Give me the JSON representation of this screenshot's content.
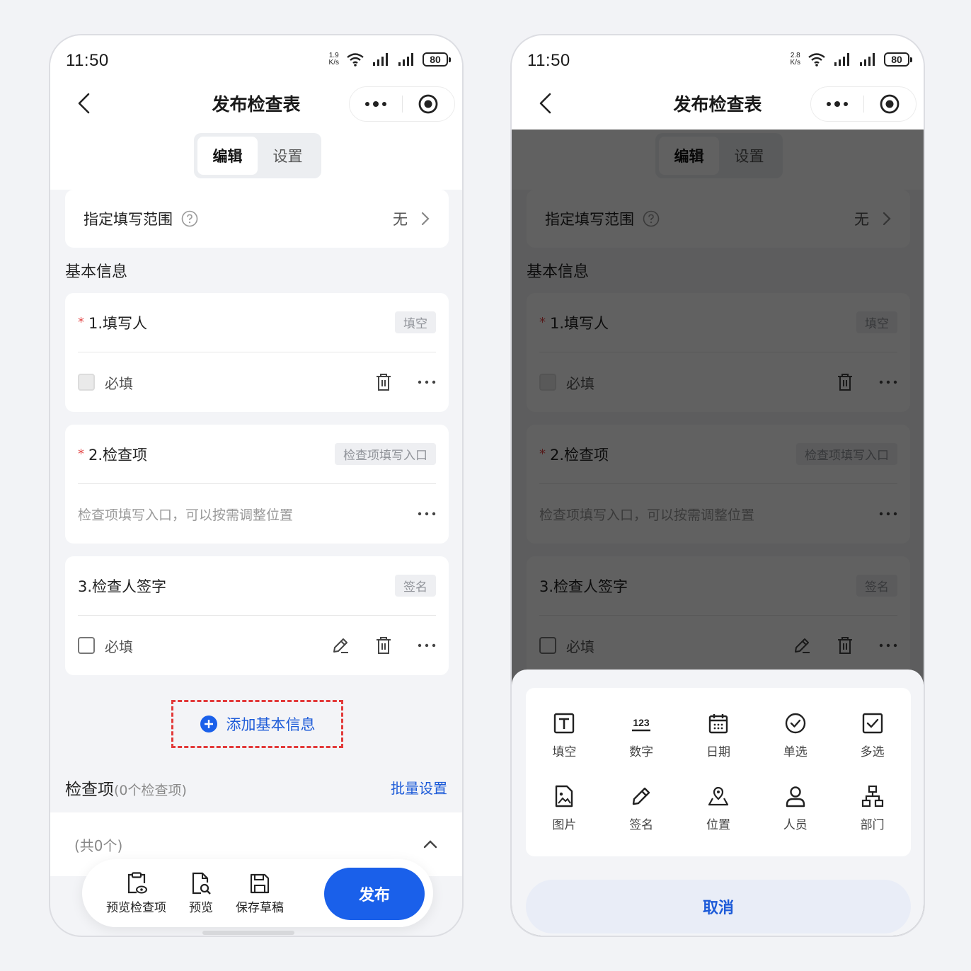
{
  "status_bar": {
    "time": "11:50",
    "left_speed_value": "1.9",
    "right_speed_value": "2.8",
    "speed_unit": "K/s",
    "battery": "80"
  },
  "nav": {
    "title": "发布检查表"
  },
  "tabs": [
    {
      "label": "编辑",
      "active": true
    },
    {
      "label": "设置",
      "active": false
    }
  ],
  "range": {
    "label": "指定填写范围",
    "value": "无"
  },
  "basic_section_title": "基本信息",
  "fields": [
    {
      "required": true,
      "required_mark": "*",
      "title": "1.填写人",
      "tag": "填空",
      "foot_label": "必填"
    },
    {
      "required": true,
      "required_mark": "*",
      "title": "2.检查项",
      "tag": "检查项填写入口",
      "foot_placeholder": "检查项填写入口，可以按需调整位置"
    },
    {
      "required": false,
      "title": "3.检查人签字",
      "tag": "签名",
      "foot_label": "必填"
    }
  ],
  "add_basic": {
    "label": "添加基本信息"
  },
  "check_section": {
    "title": "检查项",
    "count_text": "(0个检查项)",
    "batch_label": "批量设置",
    "total_text": "(共0个)"
  },
  "bottom_bar": {
    "preview_items": "预览检查项",
    "preview": "预览",
    "save_draft": "保存草稿",
    "publish": "发布"
  },
  "sheet": {
    "items": [
      {
        "label": "填空",
        "icon": "text-field-icon"
      },
      {
        "label": "数字",
        "icon": "number-icon"
      },
      {
        "label": "日期",
        "icon": "calendar-icon"
      },
      {
        "label": "单选",
        "icon": "radio-check-icon"
      },
      {
        "label": "多选",
        "icon": "checkbox-icon"
      },
      {
        "label": "图片",
        "icon": "image-icon"
      },
      {
        "label": "签名",
        "icon": "pen-icon"
      },
      {
        "label": "位置",
        "icon": "location-icon"
      },
      {
        "label": "人员",
        "icon": "person-icon"
      },
      {
        "label": "部门",
        "icon": "org-chart-icon"
      }
    ],
    "number_icon_text": "123",
    "cancel": "取消"
  },
  "colors": {
    "accent": "#1a60ea",
    "required": "#e34a4a",
    "highlight_border": "#e23a3a",
    "overlay": "rgba(0,0,0,0.62)"
  }
}
